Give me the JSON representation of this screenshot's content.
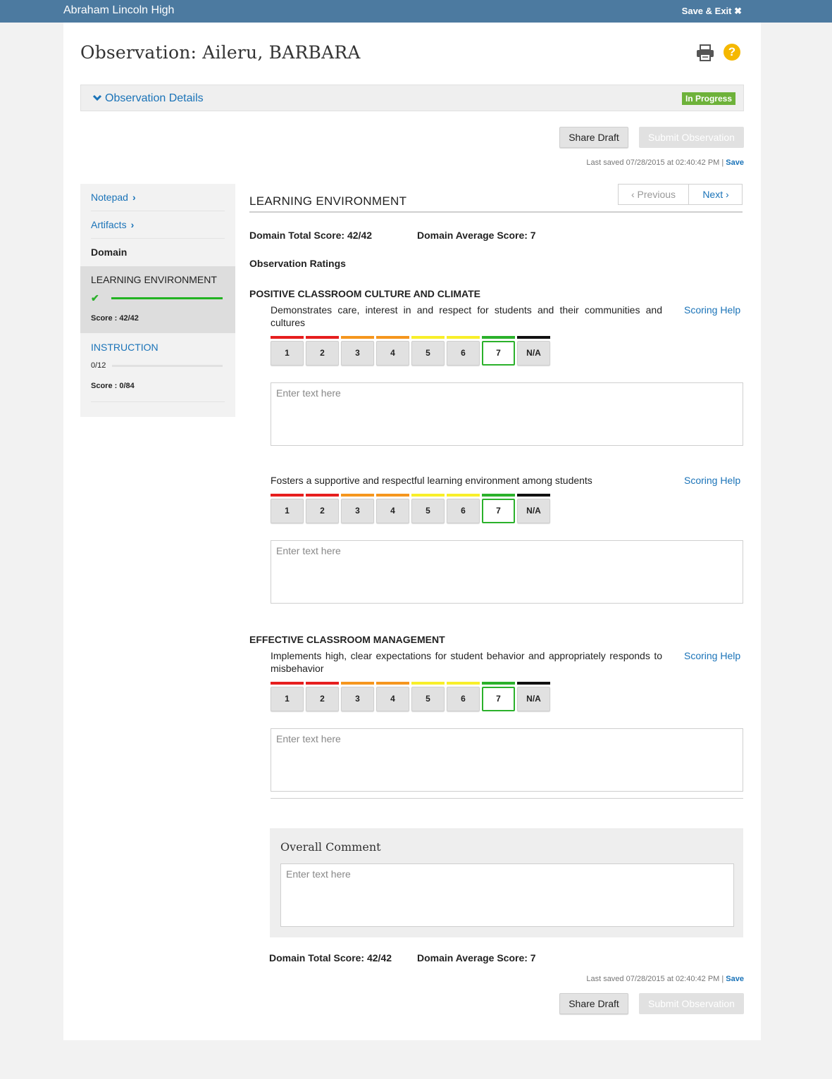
{
  "header": {
    "school": "Abraham Lincoln High",
    "save_exit": "Save & Exit ✖"
  },
  "page": {
    "title": "Observation: Aileru, BARBARA"
  },
  "details": {
    "label": "Observation Details",
    "status": "In Progress"
  },
  "actions": {
    "share_draft": "Share Draft",
    "submit": "Submit Observation"
  },
  "last_saved": {
    "text": "Last saved 07/28/2015 at 02:40:42 PM | ",
    "save_link": "Save"
  },
  "sidebar": {
    "notepad": "Notepad",
    "artifacts": "Artifacts",
    "domain_label": "Domain",
    "domains": [
      {
        "name": "LEARNING ENVIRONMENT",
        "score": "Score : 42/42",
        "complete": true,
        "progress": 1.0
      },
      {
        "name": "INSTRUCTION",
        "count": "0/12",
        "score": "Score : 0/84",
        "progress": 0.0
      }
    ]
  },
  "main": {
    "domain_title": "LEARNING ENVIRONMENT",
    "previous": "Previous",
    "next": "Next",
    "total_score": "Domain Total Score: 42/42",
    "average_score": "Domain Average Score: 7",
    "ratings_label": "Observation Ratings",
    "scoring_help": "Scoring Help",
    "placeholder": "Enter text here",
    "rating_labels": [
      "1",
      "2",
      "3",
      "4",
      "5",
      "6",
      "7",
      "N/A"
    ],
    "rating_colors": [
      "#e61e1e",
      "#e61e1e",
      "#f5961e",
      "#f5961e",
      "#f8ef2a",
      "#f8ef2a",
      "#2bb12b",
      "#111111"
    ],
    "selected_rating": "7",
    "sections": [
      {
        "title": "POSITIVE CLASSROOM CULTURE AND CLIMATE",
        "criteria": [
          "Demonstrates care, interest in and respect for students and their communities and cultures",
          "Fosters a supportive and respectful learning environment among students"
        ]
      },
      {
        "title": "EFFECTIVE CLASSROOM MANAGEMENT",
        "criteria": [
          "Implements high, clear expectations for student behavior and appropriately responds to misbehavior"
        ]
      }
    ],
    "overall_comment": "Overall Comment"
  }
}
